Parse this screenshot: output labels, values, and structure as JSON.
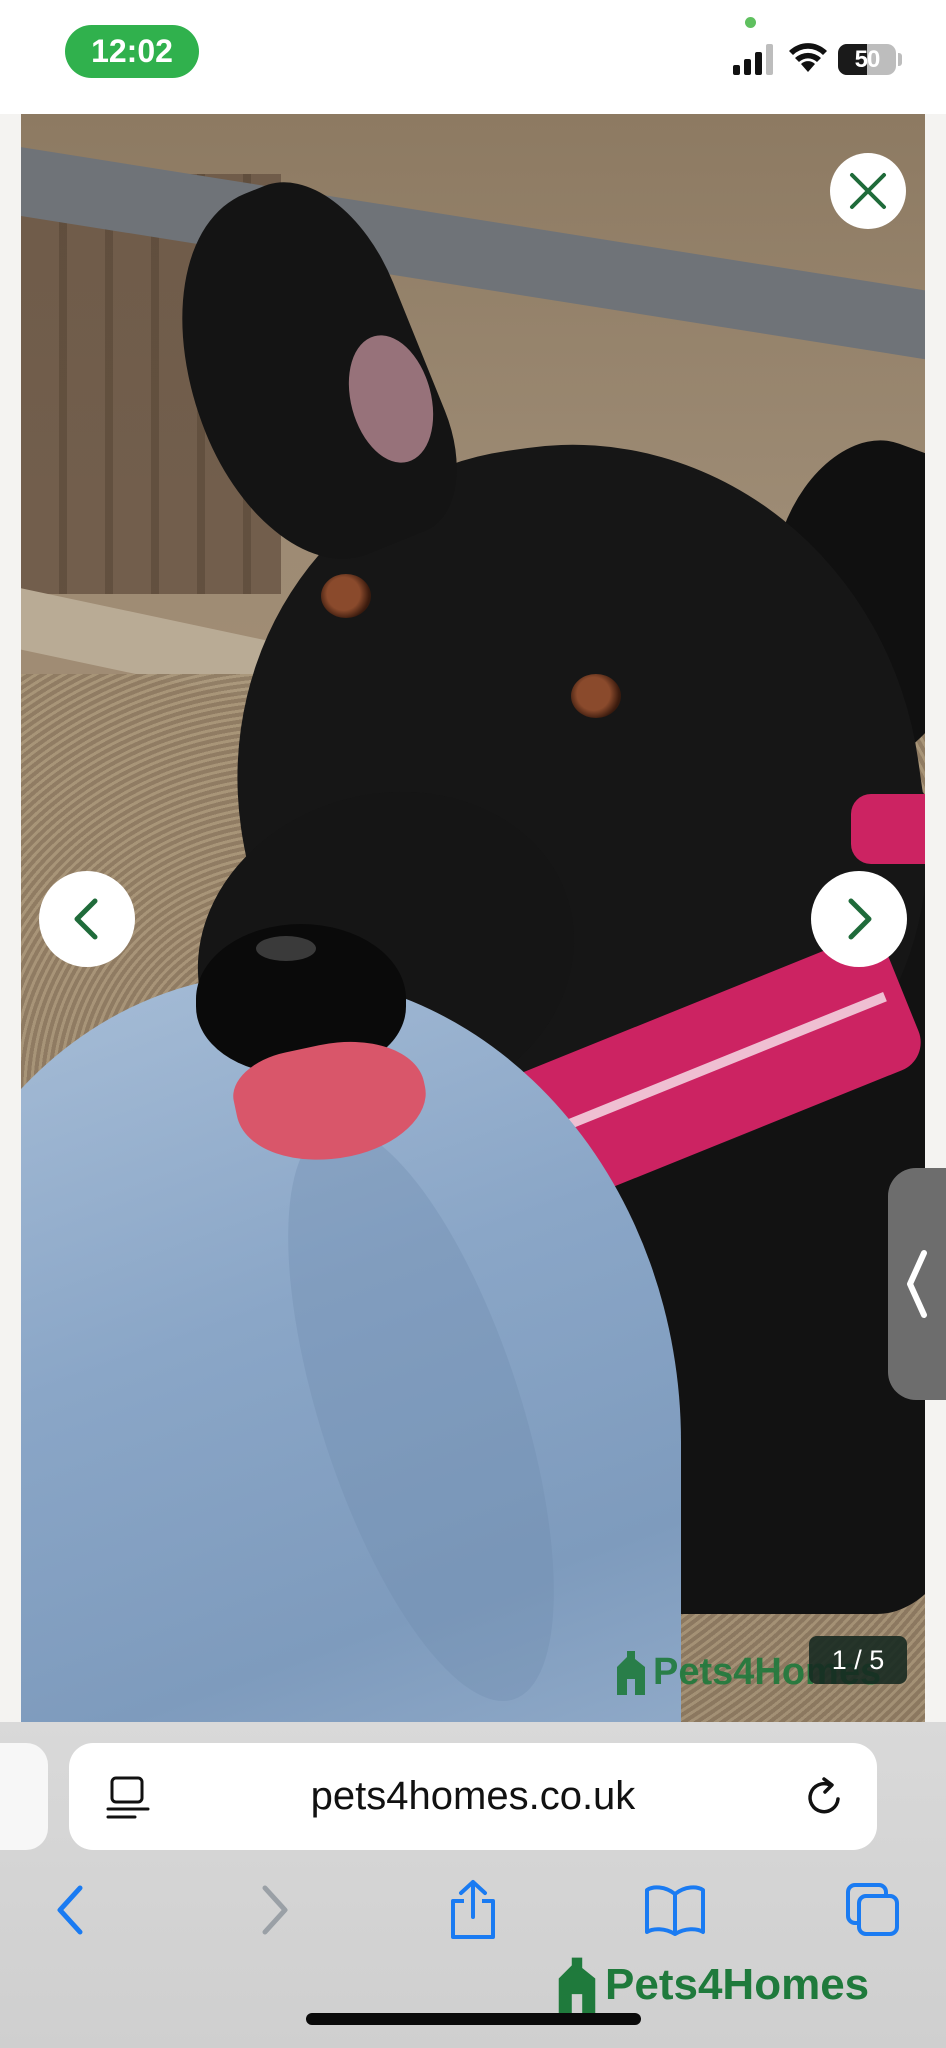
{
  "status_bar": {
    "time": "12:02",
    "battery_level": "50",
    "icons": [
      "cellular-signal-icon",
      "wifi-icon",
      "battery-icon"
    ],
    "colors": {
      "time_pill": "#30b14d"
    }
  },
  "gallery": {
    "counter": "1 / 5",
    "current_index": 1,
    "total": 5,
    "watermark": "Pets4Homes",
    "icons": {
      "close": "close-icon",
      "previous": "chevron-left-icon",
      "next": "chevron-right-icon",
      "side_panel": "chevron-left-icon"
    },
    "colors": {
      "accent": "#1f6b3a"
    }
  },
  "browser": {
    "url": "pets4homes.co.uk",
    "icons": [
      "reader-view-icon",
      "reload-icon",
      "back-icon",
      "forward-icon",
      "share-icon",
      "bookmarks-icon",
      "tabs-icon"
    ],
    "colors": {
      "toolbar_icon": "#1a7bf2"
    }
  },
  "brand": {
    "name": "Pets4Homes",
    "color": "#1f7a3c"
  }
}
